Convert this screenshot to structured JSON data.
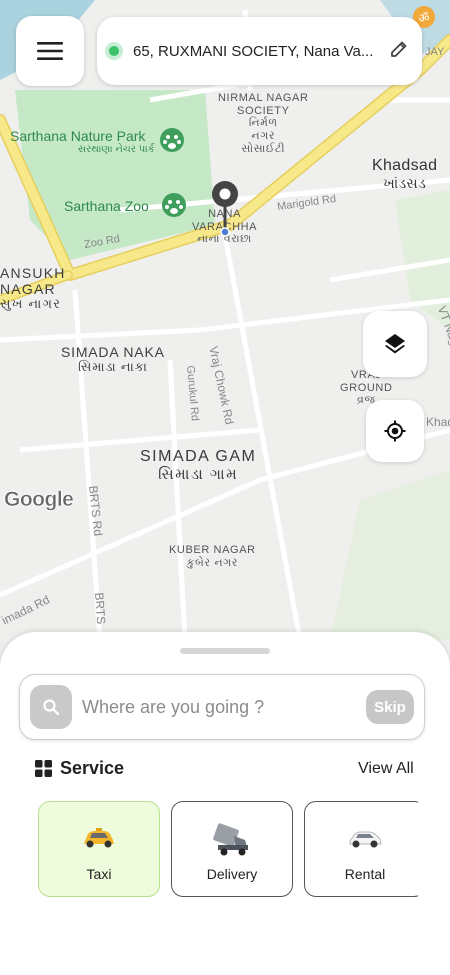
{
  "header": {
    "address": "65, RUXMANI SOCIETY, Nana Va...",
    "menu_icon": "hamburger-icon",
    "edit_icon": "pencil-icon"
  },
  "map": {
    "labels": {
      "nirmal_nagar": "NIRMAL NAGAR",
      "nirmal_society": "SOCIETY",
      "nirmal_guj1": "નિર્મળ",
      "nirmal_guj2": "નગર",
      "nirmal_guj3": "સોસાઈટી",
      "nature_park": "Sarthana Nature Park",
      "nature_park_guj": "સરથાણા નેચર પાર્ક",
      "zoo": "Sarthana Zoo",
      "khadsad": "Khadsad",
      "khadsad_guj": "ખાંડસડ",
      "nana_1": "NANA",
      "nana_2": "VARACHHA",
      "nana_guj": "નાના વરાછા",
      "marigold": "Marigold Rd",
      "zoo_rd": "Zoo Rd",
      "ansukh_1": "ANSUKH",
      "ansukh_2": "NAGAR",
      "ansukh_guj": "સુખ નાગર",
      "simada_naka": "SIMADA NAKA",
      "simada_naka_guj": "સિમાડા નાકા",
      "vraj_chowk": "Vraj Chowk Rd",
      "gurukul": "Gurukul Rd",
      "vrajbhumi_1": "VRAJ",
      "vrajbhumi_2": "GROUND",
      "vrajbhumi_guj": "વ્રજ",
      "khad": "Khad",
      "vt_nagar": "VT Nag",
      "jay": "JAY",
      "simada_gam": "SIMADA GAM",
      "simada_gam_guj": "સિમાડા ગામ",
      "brts_rd": "BRTS Rd",
      "brts_2": "BRTS",
      "kuber_nagar": "KUBER NAGAR",
      "kuber_guj": "કુબેર નગર",
      "simada_rd": "imada Rd"
    },
    "google_logo": "Google",
    "colors": {
      "highway": "#f7e88a",
      "park": "#c5e8c6",
      "water": "#aad3df"
    }
  },
  "controls": {
    "layers_icon": "layers-icon",
    "location_icon": "my-location-icon"
  },
  "sheet": {
    "search_placeholder": "Where are you going ?",
    "skip_label": "Skip",
    "service_title": "Service",
    "view_all_label": "View All",
    "services": [
      {
        "label": "Taxi",
        "icon": "taxi-icon",
        "active": true
      },
      {
        "label": "Delivery",
        "icon": "delivery-truck-icon",
        "active": false
      },
      {
        "label": "Rental",
        "icon": "rental-car-icon",
        "active": false
      }
    ],
    "accent_color": "#eefbdc"
  }
}
